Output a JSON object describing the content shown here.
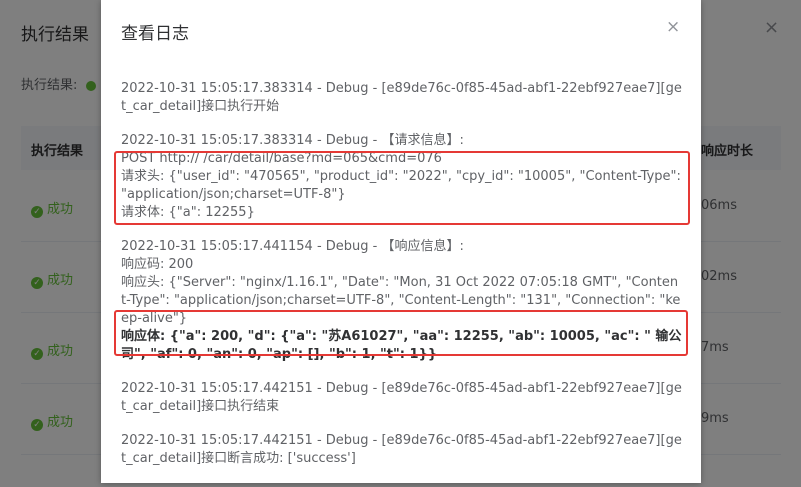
{
  "background": {
    "title": "执行结果",
    "result_label": "执行结果:",
    "table_header": {
      "status_col": "执行结果",
      "duration_col": "响应时长"
    },
    "rows": [
      {
        "status": "成功",
        "duration": "06ms"
      },
      {
        "status": "成功",
        "duration": "02ms"
      },
      {
        "status": "成功",
        "duration": "7ms"
      },
      {
        "status": "成功",
        "duration": "9ms"
      }
    ]
  },
  "dialog": {
    "title": "查看日志",
    "close_glyph": "×",
    "log": [
      {
        "lines": [
          "2022-10-31 15:05:17.383314 - Debug - [e89de76c-0f85-45ad-abf1-22ebf927eae7][get_car_detail]接口执行开始"
        ]
      },
      {
        "lines": [
          "2022-10-31 15:05:17.383314 - Debug - 【请求信息】:",
          "POST http://                                        /car/detail/base?md=065&cmd=076",
          "请求头: {\"user_id\": \"470565\", \"product_id\": \"2022\", \"cpy_id\": \"10005\", \"Content-Type\": \"application/json;charset=UTF-8\"}",
          "请求体: {\"a\": 12255}"
        ]
      },
      {
        "lines": [
          "2022-10-31 15:05:17.441154 - Debug - 【响应信息】:",
          "响应码: 200",
          "响应头: {\"Server\": \"nginx/1.16.1\", \"Date\": \"Mon, 31 Oct 2022 07:05:18 GMT\", \"Content-Type\": \"application/json;charset=UTF-8\", \"Content-Length\": \"131\", \"Connection\": \"keep-alive\"}",
          "响应体: {\"a\": 200, \"d\": {\"a\": \"苏A61027\", \"aa\": 12255, \"ab\": 10005, \"ac\": \"              输公司\", \"af\": 0, \"an\": 0, \"ap\": [], \"b\": 1, \"t\": 1}}"
        ]
      },
      {
        "lines": [
          "2022-10-31 15:05:17.442151 - Debug - [e89de76c-0f85-45ad-abf1-22ebf927eae7][get_car_detail]接口执行结束"
        ]
      },
      {
        "lines": [
          "2022-10-31 15:05:17.442151 - Debug - [e89de76c-0f85-45ad-abf1-22ebf927eae7][get_car_detail]接口断言成功: ['success']"
        ]
      }
    ]
  },
  "colors": {
    "highlight": "#e53935",
    "success": "#67c23a"
  }
}
